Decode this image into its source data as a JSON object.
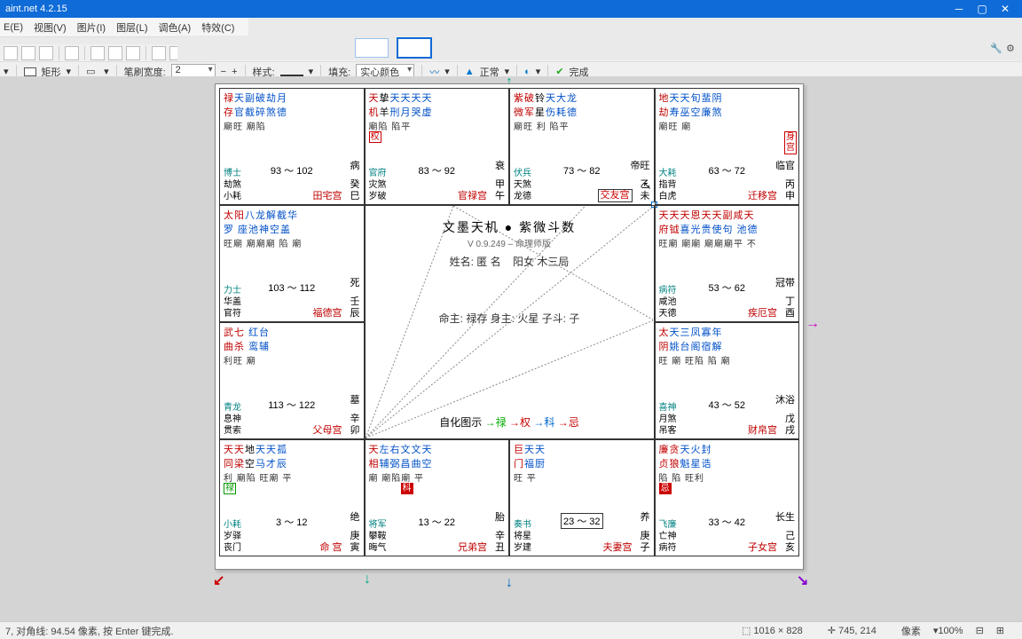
{
  "titlebar": {
    "app": "aint.net 4.2.15"
  },
  "menu": [
    "E(E)",
    "视图(V)",
    "图片(I)",
    "图层(L)",
    "调色(A)",
    "特效(C)"
  ],
  "tb2": {
    "shape": "矩形",
    "bw_lbl": "笔刷宽度:",
    "bw_val": "2",
    "style": "样式:",
    "fill_lbl": "填充:",
    "fill_val": "实心颜色",
    "normal": "正常",
    "done": "完成"
  },
  "status": {
    "left": "7,  对角线: 94.54 像素,  按 Enter 键完成.",
    "dims": "1016 × 828",
    "pos": "745, 214",
    "unit": "像素",
    "zoom": "100%"
  },
  "center": {
    "title": "文墨天机 ● 紫微斗数",
    "sub": "V 0.9.249 – 命理师版",
    "name_lbl": "姓名: 匿 名",
    "bureau": "阳女  木三局",
    "cmd": "命主: 禄存  身主: 火星  子斗: 子",
    "legend_lbl": "自化图示",
    "l1": "→禄",
    "l2": "→权",
    "l3": "→科",
    "l4": "→忌"
  },
  "cells": {
    "p0": {
      "t1a": "禄",
      "t1b": "天副破劫月",
      "t2a": "存",
      "t2b": "官截碎煞德",
      "t3": "廟旺 廟陷",
      "bl1": "博士",
      "bl2": "劫煞",
      "bl3": "小耗",
      "range": "93 ～ 102",
      "brTop": "病",
      "br1": "癸",
      "br2": "巳",
      "pal": "田宅宫"
    },
    "p1": {
      "t1a": "天",
      "t1b": "挚",
      "t1c": "天天天天",
      "t2a": "机",
      "t2b": "羊",
      "t2c": "刑月哭虚",
      "t3": "廟陷        陷平",
      "badge": "权",
      "bl1": "官府",
      "bl2": "灾煞",
      "bl3": "岁破",
      "range": "83 ～ 92",
      "brTop": "衰",
      "br1": "甲",
      "br2": "午",
      "pal": "官禄宫"
    },
    "p2": {
      "t1a": "紫破",
      "t1b": "铃",
      "t1c": "天大龙",
      "t2a": "微军",
      "t2b": "星",
      "t2c": "伤耗德",
      "t3": "廟旺 利 陷平",
      "bl1": "伏兵",
      "bl2": "天煞",
      "bl3": "龙德",
      "range": "73 ～ 82",
      "brTop": "帝旺",
      "br1": "乙",
      "br2": "未",
      "pal": "交友宫",
      "sel": true
    },
    "p3": {
      "t1a": "地",
      "t1b": "天天旬蜚阴",
      "t2a": "劫",
      "t2b": "寿巫空廉煞",
      "t3": "廟旺     廟",
      "shen": "身宫",
      "bl1": "大耗",
      "bl2": "指背",
      "bl3": "白虎",
      "range": "63 ～ 72",
      "brTop": "临官",
      "br1": "丙",
      "br2": "申",
      "pal": "迁移宫"
    },
    "p4": {
      "t1a": "太阳",
      "t1b": "八龙解截华",
      "t2a": "",
      "t2b": "罗 座池神空盖",
      "t3": "旺廟  廟廟廟 陷 廟",
      "bl1": "力士",
      "bl2": "华盖",
      "bl3": "官符",
      "range": "103 ～ 112",
      "brTop": "死",
      "br1": "壬",
      "br2": "辰",
      "pal": "福德宫"
    },
    "p5": {
      "t1a": "天天天恩天天副咸天",
      "t1b": "",
      "t2a": "府钺",
      "t2b": "喜光贵使句  池德",
      "t3": "旺廟 廟廟 廟廟廟平 不",
      "bl1": "病符",
      "bl2": "咸池",
      "bl3": "天德",
      "range": "53 ～ 62",
      "brTop": "冠带",
      "br1": "丁",
      "br2": "酉",
      "pal": "疾厄宫"
    },
    "p6": {
      "t1a": "武七",
      "t1b": "红台",
      "t2a": "曲杀",
      "t2b": "鸾辅",
      "t3": "利旺 廟",
      "bl1": "青龙",
      "bl2": "息神",
      "bl3": "贯索",
      "range": "113 ～ 122",
      "brTop": "墓",
      "br1": "辛",
      "br2": "卯",
      "pal": "父母宫"
    },
    "p7": {
      "t1a": "太",
      "t1b": "天三凤寡年",
      "t2a": "阴",
      "t2b": "姚台阁宿解",
      "t3": "旺 廟 旺陷 陷 廟",
      "bl1": "喜神",
      "bl2": "月煞",
      "bl3": "吊客",
      "range": "43 ～ 52",
      "brTop": "沐浴",
      "br1": "戊",
      "br2": "戌",
      "pal": "财帛宫"
    },
    "p8": {
      "t1a": "天天",
      "t1b": "地",
      "t1c": "天天孤",
      "t2a": "同梁",
      "t2b": "空",
      "t2c": "马才辰",
      "t3": "利 廟陷 旺廟 平",
      "badge": "禄",
      "bl1": "小耗",
      "bl2": "岁驿",
      "bl3": "丧门",
      "range": "3 ～ 12",
      "brTop": "绝",
      "br1": "庚",
      "br2": "寅",
      "pal": "命 宫"
    },
    "p9": {
      "t1a": "天",
      "t1b": "左右文文天",
      "t2a": "相",
      "t2b": "辅弼昌曲空",
      "t3": "廟 廟陷廟 平",
      "badge": "科",
      "bl1": "将军",
      "bl2": "攀鞍",
      "bl3": "晦气",
      "range": "13 ～ 22",
      "brTop": "胎",
      "br1": "辛",
      "br2": "丑",
      "pal": "兄弟宫"
    },
    "p10": {
      "t1a": "巨",
      "t1b": "天天",
      "t2a": "门",
      "t2b": "福厨",
      "t3": "旺 平",
      "bl1": "奏书",
      "bl2": "将星",
      "bl3": "岁建",
      "range": "23 ～ 32",
      "sel": true,
      "brTop": "养",
      "br1": "庚",
      "br2": "子",
      "pal": "夫妻宫"
    },
    "p11": {
      "t1a": "廉贪",
      "t1b": "天火封",
      "t2a": "贞狼",
      "t2b": "魁星诰",
      "t3": "陷 陷 旺利",
      "badge": "忌",
      "bl1": "飞廉",
      "bl2": "亡神",
      "bl3": "病符",
      "range": "33 ～ 42",
      "brTop": "长生",
      "br1": "己",
      "br2": "亥",
      "pal": "子女宫"
    }
  }
}
